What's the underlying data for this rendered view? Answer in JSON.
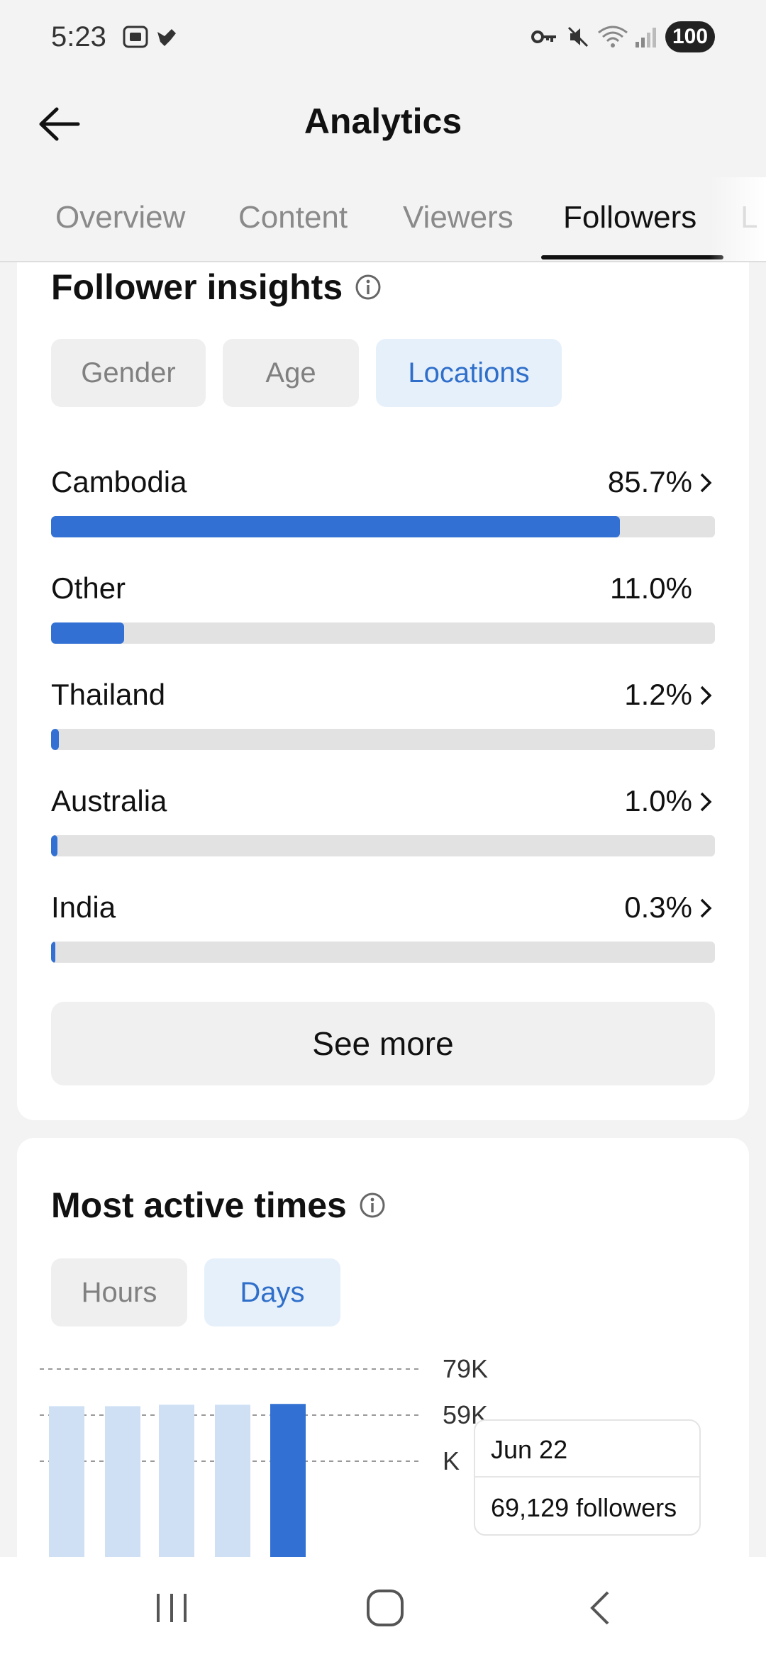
{
  "status": {
    "time": "5:23",
    "battery": "100"
  },
  "header": {
    "title": "Analytics"
  },
  "tabs": [
    {
      "label": "Overview",
      "active": false
    },
    {
      "label": "Content",
      "active": false
    },
    {
      "label": "Viewers",
      "active": false
    },
    {
      "label": "Followers",
      "active": true
    },
    {
      "label": "L",
      "active": false
    }
  ],
  "insights": {
    "title": "Follower insights",
    "filters": [
      {
        "label": "Gender",
        "active": false
      },
      {
        "label": "Age",
        "active": false
      },
      {
        "label": "Locations",
        "active": true
      }
    ],
    "locations": [
      {
        "name": "Cambodia",
        "percent": "85.7%",
        "value": 85.7,
        "chevron": true
      },
      {
        "name": "Other",
        "percent": "11.0%",
        "value": 11.0,
        "chevron": false
      },
      {
        "name": "Thailand",
        "percent": "1.2%",
        "value": 1.2,
        "chevron": true
      },
      {
        "name": "Australia",
        "percent": "1.0%",
        "value": 1.0,
        "chevron": true
      },
      {
        "name": "India",
        "percent": "0.3%",
        "value": 0.3,
        "chevron": true
      }
    ],
    "see_more": "See more"
  },
  "active_times": {
    "title": "Most active times",
    "filters": [
      {
        "label": "Hours",
        "active": false
      },
      {
        "label": "Days",
        "active": true
      }
    ],
    "tooltip": {
      "date": "Jun 22",
      "value": "69,129 followers"
    }
  },
  "chart_data": {
    "type": "bar",
    "y_ticks": [
      "79K",
      "59K",
      "K"
    ],
    "ylim": [
      0,
      79000
    ],
    "values": [
      68500,
      68500,
      68900,
      68900,
      69129
    ],
    "highlight_index": 4,
    "colors": {
      "normal": "#cfe0f5",
      "highlight": "#3271d3"
    },
    "grid": true
  },
  "colors": {
    "accent": "#3271d3",
    "pill_active_bg": "#e6f0fb",
    "track": "#e2e2e2"
  }
}
